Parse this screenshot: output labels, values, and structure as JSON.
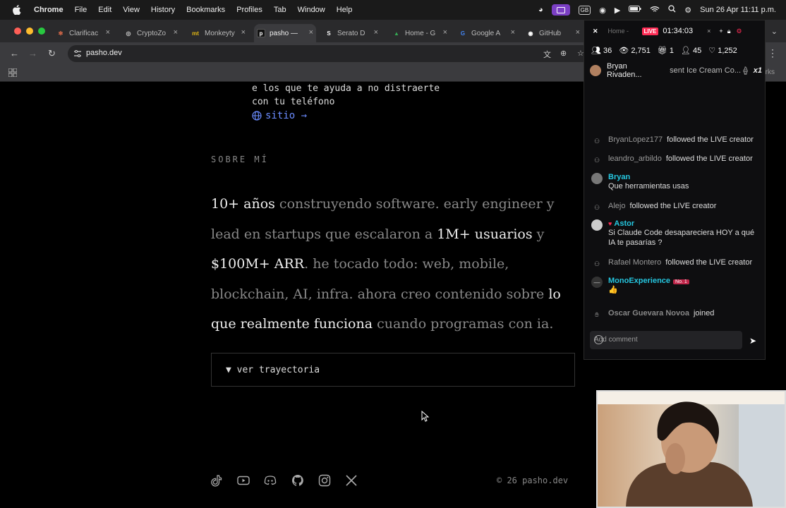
{
  "menubar": {
    "app": "Chrome",
    "items": [
      "File",
      "Edit",
      "View",
      "History",
      "Bookmarks",
      "Profiles",
      "Tab",
      "Window",
      "Help"
    ],
    "keyboard": "GB",
    "datetime": "Sun 26 Apr  11:11 p.m."
  },
  "tabs": [
    {
      "title": "Clarificac",
      "fav": "✻",
      "color": "#e06c4a"
    },
    {
      "title": "CryptoZo",
      "fav": "◎",
      "color": "#555"
    },
    {
      "title": "Monkeyty",
      "fav": "mt",
      "color": "#e2b714"
    },
    {
      "title": "pasho — ",
      "fav": "p",
      "color": "#222",
      "active": true
    },
    {
      "title": "Serato D",
      "fav": "S",
      "color": "#2a2a2c"
    },
    {
      "title": "Home - G",
      "fav": "▲",
      "color": "#1a73e8"
    },
    {
      "title": "Google A",
      "fav": "G",
      "color": "#fff"
    },
    {
      "title": "GitHub",
      "fav": "◉",
      "color": "#fff"
    }
  ],
  "address": {
    "url": "pasho.dev"
  },
  "bookmarks": {
    "all_label": "All Bookmarks"
  },
  "page": {
    "project_desc_line1": "e los que te ayuda a no distraerte",
    "project_desc_line2": "con tu teléfono",
    "site_link": "sitio →",
    "about_heading": "SOBRE MÍ",
    "bio": [
      {
        "t": "10+ años",
        "hl": true
      },
      {
        "t": " construyendo software. early engineer y lead en startups que escalaron a ",
        "hl": false
      },
      {
        "t": "1M+ usuarios",
        "hl": true
      },
      {
        "t": " y ",
        "hl": false
      },
      {
        "t": "$100M+ ARR",
        "hl": true
      },
      {
        "t": ". he tocado todo: web, mobile, blockchain, AI, infra. ahora creo contenido sobre ",
        "hl": false
      },
      {
        "t": "lo que realmente funciona",
        "hl": true
      },
      {
        "t": " cuando programas con ia.",
        "hl": false
      }
    ],
    "trajectory_toggle": "▼ ver trayectoria",
    "social": [
      "tiktok",
      "youtube",
      "discord",
      "github",
      "instagram",
      "x"
    ],
    "copyright": "© 26 pasho.dev"
  },
  "live": {
    "tab_title": "Home - ",
    "badge": "LIVE",
    "timer": "01:34:03",
    "stats": {
      "users": "36",
      "views": "2,751",
      "gifts": "1",
      "people": "45",
      "likes": "1,252"
    },
    "gift": {
      "user": "Bryan Rivaden...",
      "text": "sent Ice Cream Co...",
      "count": "x1"
    },
    "feed": [
      {
        "type": "follow",
        "name": "BryanLopez177",
        "text": "followed the LIVE creator"
      },
      {
        "type": "follow",
        "name": "leandro_arbildo",
        "text": "followed the LIVE creator"
      },
      {
        "type": "comment",
        "name": "Bryan",
        "text": "Que herramientas usas"
      },
      {
        "type": "follow",
        "name": "Alejo",
        "text": "followed the LIVE creator"
      },
      {
        "type": "comment",
        "name": "Astor",
        "text": "Si Claude Code desapareciera HOY a qué IA te pasarías ?"
      },
      {
        "type": "follow",
        "name": "Rafael Montero",
        "text": "followed the LIVE creator"
      },
      {
        "type": "comment",
        "name": "MonoExperience",
        "text": "👍",
        "badge": "No. 1"
      },
      {
        "type": "join",
        "name": "Oscar Guevara Novoa",
        "text": "joined"
      }
    ],
    "comment_placeholder": "Add comment"
  },
  "colors": {
    "accent_link": "#6b8cff",
    "live_red": "#fe2c55",
    "tiktok_cyan": "#25c7e0"
  }
}
